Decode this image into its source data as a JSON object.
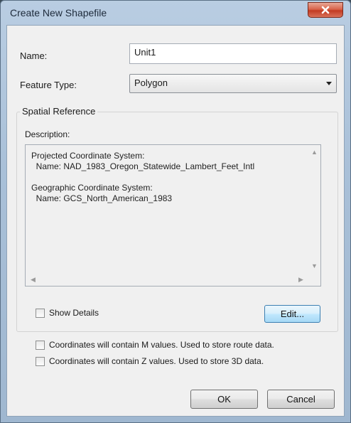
{
  "window": {
    "title": "Create New Shapefile"
  },
  "form": {
    "name_label": "Name:",
    "name_value": "Unit1",
    "feature_type_label": "Feature Type:",
    "feature_type_value": "Polygon"
  },
  "spatial_reference": {
    "group_label": "Spatial Reference",
    "description_label": "Description:",
    "description_text": "Projected Coordinate System:\n  Name: NAD_1983_Oregon_Statewide_Lambert_Feet_Intl\n\nGeographic Coordinate System:\n  Name: GCS_North_American_1983",
    "show_details_label": "Show Details",
    "edit_label": "Edit..."
  },
  "options": {
    "m_values_label": "Coordinates will contain M values. Used to store route data.",
    "z_values_label": "Coordinates will contain Z values. Used to store 3D data."
  },
  "buttons": {
    "ok_label": "OK",
    "cancel_label": "Cancel"
  },
  "icons": {
    "close": "close-icon",
    "dropdown": "chevron-down-icon"
  },
  "colors": {
    "close_button": "#c23b22",
    "titlebar": "#b9cde2",
    "dialog_bg": "#f0f0f0"
  }
}
